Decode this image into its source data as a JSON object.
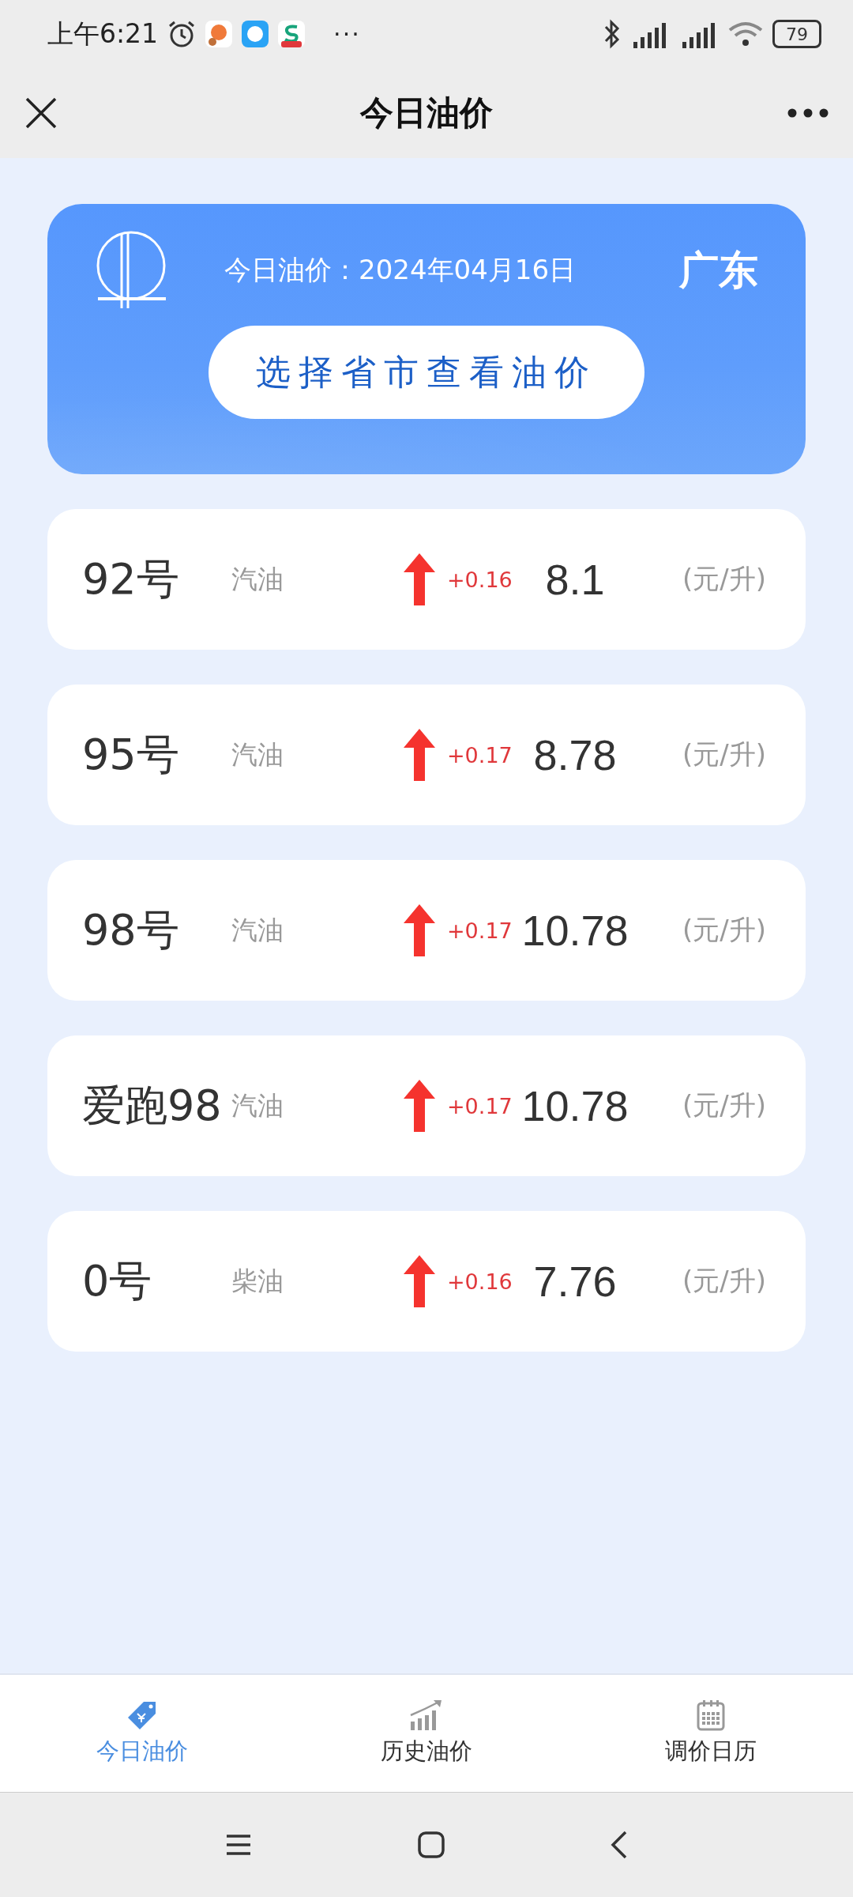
{
  "status_bar": {
    "time": "上午6:21",
    "more": "···",
    "battery": "79"
  },
  "header": {
    "title": "今日油价"
  },
  "banner": {
    "date_label": "今日油价：2024年04月16日",
    "province": "广东",
    "button": "选择省市查看油价"
  },
  "prices": [
    {
      "grade": "92号",
      "type": "汽油",
      "kind": "rise",
      "change": "+0.16",
      "price": "8.1",
      "unit": "(元/升)"
    },
    {
      "grade": "95号",
      "type": "汽油",
      "kind": "rise",
      "change": "+0.17",
      "price": "8.78",
      "unit": "(元/升)"
    },
    {
      "grade": "98号",
      "type": "汽油",
      "kind": "rise",
      "change": "+0.17",
      "price": "10.78",
      "unit": "(元/升)"
    },
    {
      "grade": "爱跑98",
      "type": "汽油",
      "kind": "rise",
      "change": "+0.17",
      "price": "10.78",
      "unit": "(元/升)"
    },
    {
      "grade": "0号",
      "type": "柴油",
      "kind": "rise",
      "change": "+0.16",
      "price": "7.76",
      "unit": "(元/升)"
    }
  ],
  "tabs": [
    {
      "label": "今日油价",
      "selected": true
    },
    {
      "label": "历史油价",
      "selected": false
    },
    {
      "label": "调价日历",
      "selected": false
    }
  ]
}
